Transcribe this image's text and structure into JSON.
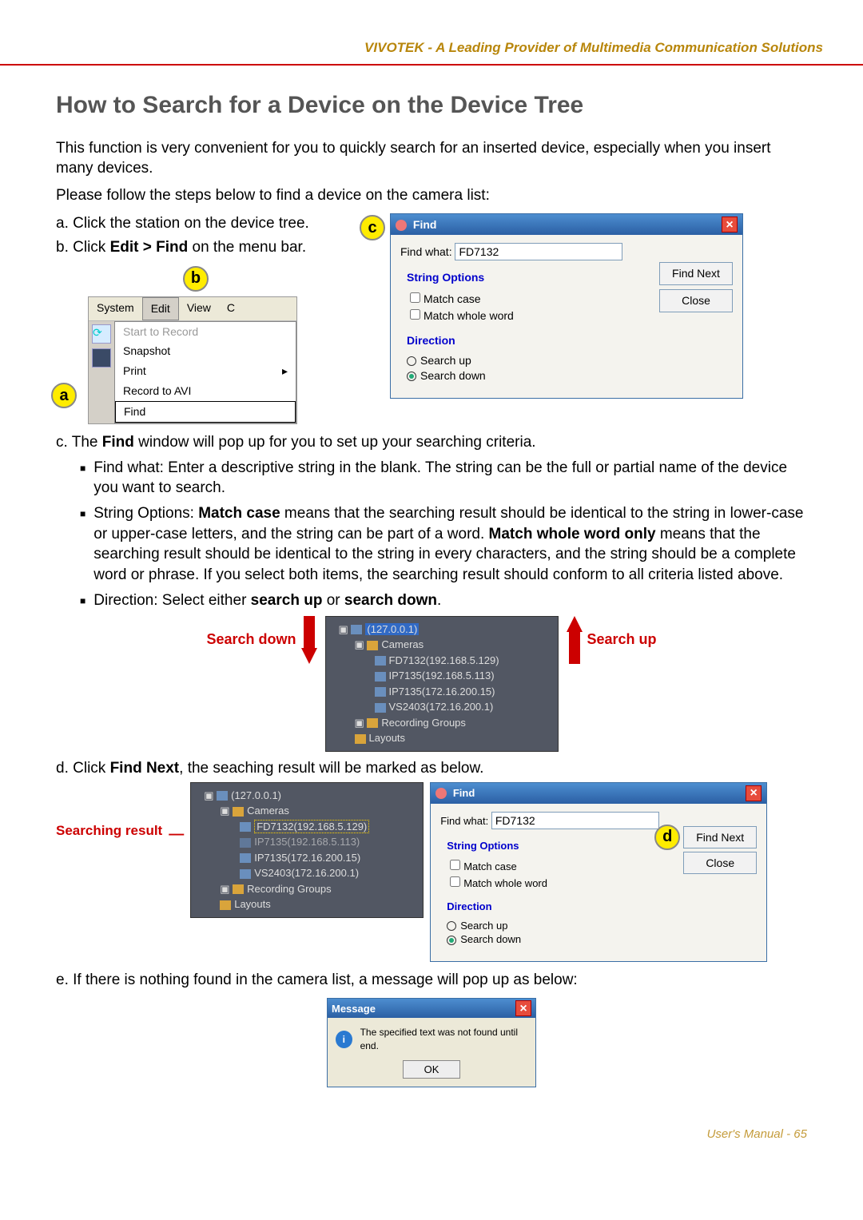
{
  "header": {
    "tagline": "VIVOTEK - A Leading Provider of Multimedia Communication Solutions"
  },
  "title": "How to Search for a Device on the Device Tree",
  "intro_p1": "This function is very convenient for you to quickly search for an inserted device, especially when you insert many devices.",
  "intro_p2": "Please follow the steps below to find a device on the camera list:",
  "steps": {
    "a": "a. Click the station on the device tree.",
    "b_pre": "b. Click ",
    "b_bold": "Edit > Find",
    "b_post": " on the menu bar.",
    "c_pre": "c. The ",
    "c_bold": "Find",
    "c_post": " window will pop up for you to set up your searching criteria.",
    "d_pre": "d. Click ",
    "d_bold": "Find Next",
    "d_post": ", the seaching result will be marked as below.",
    "e": "e. If there is nothing found in the camera list, a message will pop up as below:"
  },
  "bullets": {
    "find_what": "Find what: Enter a descriptive string in the blank. The string can be the full or partial name of the device you want to search.",
    "string_opts_pre": "String Options: ",
    "match_case_bold": "Match case",
    "string_opts_mid1": " means that the searching result should be identical to the string in lower-case or upper-case letters, and the string can be part of a word. ",
    "match_whole_bold": "Match whole word only",
    "string_opts_mid2": " means that the searching result should be identical to the string in every characters, and the string should be a complete word or phrase. If you select both items, the searching result should conform to all criteria listed above.",
    "direction_pre": "Direction: Select either ",
    "direction_b1": "search up",
    "direction_mid": " or ",
    "direction_b2": "search down",
    "direction_post": "."
  },
  "badges": {
    "a": "a",
    "b": "b",
    "c": "c",
    "d": "d"
  },
  "menu": {
    "items": [
      "System",
      "Edit",
      "View",
      "C"
    ],
    "dropdown": [
      "Start to Record",
      "Snapshot",
      "Print",
      "Record to AVI",
      "Find"
    ]
  },
  "find_dialog": {
    "title": "Find",
    "find_what_label": "Find what:",
    "find_what_value": "FD7132",
    "string_options_legend": "String Options",
    "match_case_label": "Match case",
    "match_whole_label": "Match whole word",
    "direction_legend": "Direction",
    "search_up_label": "Search up",
    "search_down_label": "Search down",
    "find_next_btn": "Find Next",
    "close_btn": "Close",
    "close_x": "×"
  },
  "tree": {
    "root": "(127.0.0.1)",
    "cameras_label": "Cameras",
    "items": [
      "FD7132(192.168.5.129)",
      "IP7135(192.168.5.113)",
      "IP7135(172.16.200.15)",
      "VS2403(172.16.200.1)"
    ],
    "groups": [
      "Recording Groups",
      "Layouts"
    ]
  },
  "dir_labels": {
    "down": "Search down",
    "up": "Search up"
  },
  "searching_result_label": "Searching result",
  "message": {
    "title": "Message",
    "text": "The specified text was not found until end.",
    "ok": "OK",
    "close_x": "×"
  },
  "footer": "User's Manual - 65"
}
